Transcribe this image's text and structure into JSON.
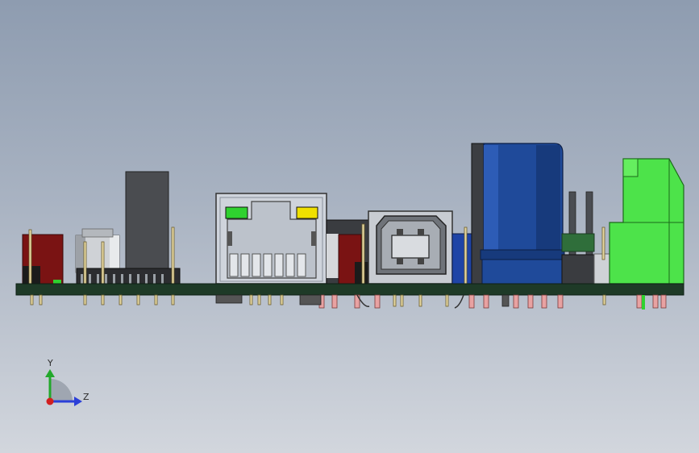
{
  "triad": {
    "y_label": "Y",
    "z_label": "Z",
    "colors": {
      "y": "#22a82b",
      "z": "#2b3fd8",
      "x_dot": "#d21f1f"
    }
  },
  "colors": {
    "pcb": "#1e3a27",
    "capacitor": "#1f4a9a",
    "terminal_block": "#4de34a",
    "rj45_body": "#cfd4dc",
    "rj45_led_left": "#2fd12f",
    "rj45_led_right": "#f0e000",
    "usb_shell": "#c8ccd2",
    "red_component": "#7a1313",
    "dark_component": "#4a4d52"
  },
  "icons": [
    "coordinate-triad-icon"
  ]
}
